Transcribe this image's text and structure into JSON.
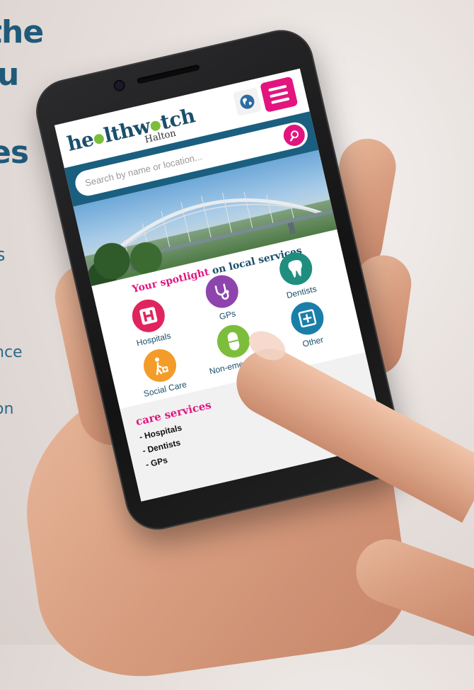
{
  "background_text": {
    "lines": [
      "the",
      "u",
      "es",
      "s",
      "nce",
      "on"
    ]
  },
  "app": {
    "logo_text": "healthwatch",
    "logo_subtitle": "Halton",
    "globe_icon": "globe-icon",
    "menu_icon": "hamburger-menu-icon",
    "accent_color": "#e2157f",
    "brand_color": "#1a4f6b"
  },
  "search": {
    "placeholder": "Search by name or location...",
    "icon": "search-icon"
  },
  "spotlight": {
    "title_pink": "Your spotlight",
    "title_blue": "on local services",
    "items": [
      {
        "label": "Hospitals",
        "icon": "hospital-icon",
        "color": "#e0245e"
      },
      {
        "label": "GPs",
        "icon": "stethoscope-icon",
        "color": "#8e44ad"
      },
      {
        "label": "Dentists",
        "icon": "tooth-icon",
        "color": "#1f8e7f"
      },
      {
        "label": "Social Care",
        "icon": "social-care-icon",
        "color": "#f39c2a"
      },
      {
        "label": "Non-emergency",
        "icon": "pill-icon",
        "color": "#7dbd3c"
      },
      {
        "label": "Other",
        "icon": "plus-square-icon",
        "color": "#1a7fa8"
      }
    ]
  },
  "care_services": {
    "title": "care services",
    "items": [
      "- Hospitals",
      "- Dentists",
      "- GPs"
    ]
  }
}
